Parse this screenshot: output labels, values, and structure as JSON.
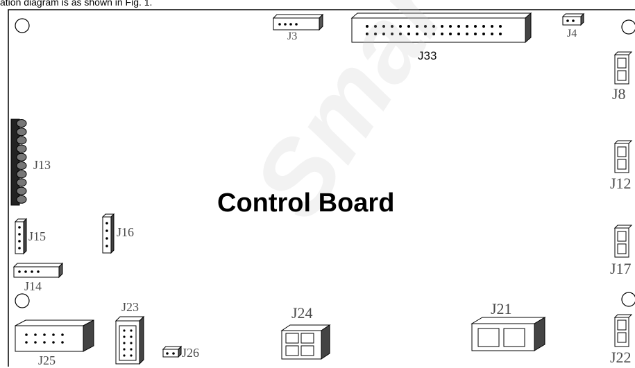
{
  "caption": "ation diagram is as shown in Fig. 1.",
  "board": {
    "title": "Control Board",
    "watermark": "SmartSa"
  },
  "connectors": {
    "J3": "J3",
    "J4": "J4",
    "J33": "J33",
    "J8": "J8",
    "J12": "J12",
    "J13": "J13",
    "J15": "J15",
    "J16": "J16",
    "J14": "J14",
    "J17": "J17",
    "J23": "J23",
    "J24": "J24",
    "J21": "J21",
    "J22": "J22",
    "J25": "J25",
    "J26": "J26"
  }
}
